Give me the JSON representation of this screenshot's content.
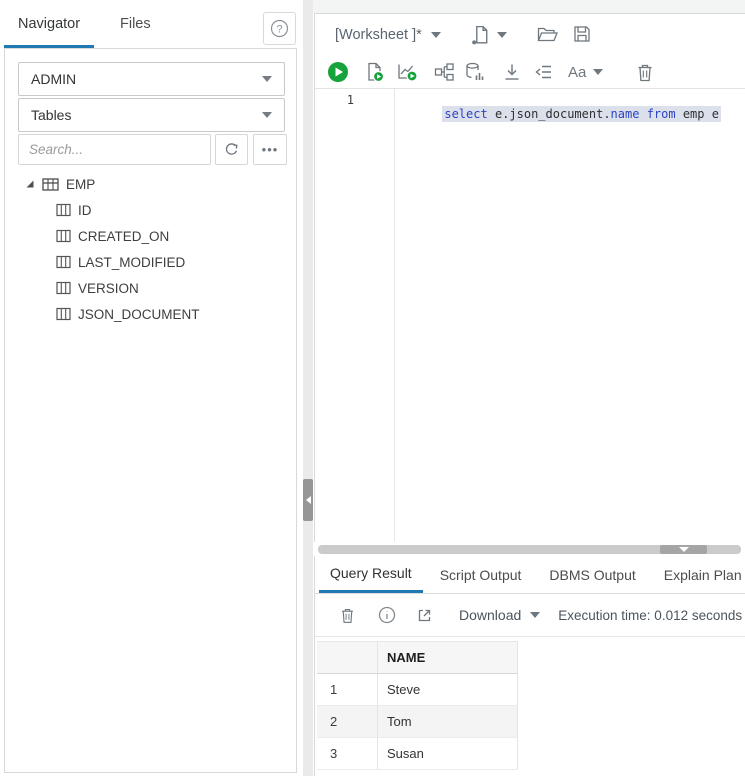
{
  "sidebar": {
    "tabs": {
      "navigator": "Navigator",
      "files": "Files"
    },
    "schema_dropdown": "ADMIN",
    "object_type_dropdown": "Tables",
    "search_placeholder": "Search...",
    "more_label": "•••",
    "tree": {
      "root_label": "EMP",
      "columns": [
        "ID",
        "CREATED_ON",
        "LAST_MODIFIED",
        "VERSION",
        "JSON_DOCUMENT"
      ]
    }
  },
  "worksheet": {
    "title": "[Worksheet ]*",
    "toolbar_icons": [
      "new-worksheet",
      "open-file",
      "save-file",
      "run-statement",
      "run-script",
      "autotrace",
      "explain-plan",
      "sql-history",
      "download-editor",
      "format-sql",
      "font-size",
      "clear-worksheet"
    ],
    "font_button_label": "Aa",
    "editor": {
      "line_number": "1",
      "code": {
        "kw1": "select",
        "plain1": " e.json_document.",
        "kw2": "name",
        "sp1": " ",
        "kw3": "from",
        "plain2": " emp e"
      }
    }
  },
  "results": {
    "tabs": [
      "Query Result",
      "Script Output",
      "DBMS Output",
      "Explain Plan"
    ],
    "active_tab": "Query Result",
    "toolbar": {
      "download_label": "Download",
      "execution_time": "Execution time: 0.012 seconds"
    },
    "grid": {
      "column_header": "NAME",
      "rows": [
        {
          "num": "1",
          "name": "Steve"
        },
        {
          "num": "2",
          "name": "Tom"
        },
        {
          "num": "3",
          "name": "Susan"
        }
      ]
    }
  },
  "colors": {
    "accent_blue": "#2079b0",
    "run_green": "#16a33c",
    "keyword_blue": "#2b43c4",
    "selection": "#dbe0eb"
  }
}
